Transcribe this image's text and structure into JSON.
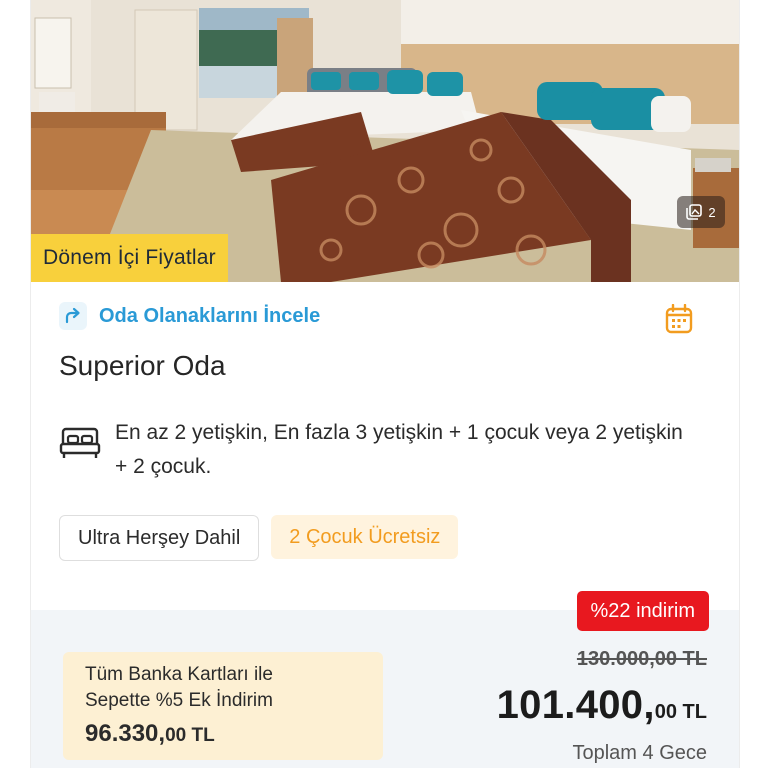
{
  "photo": {
    "alt": "Superior room photo with two beds",
    "gallery_count": "2",
    "gallery_icon": "images-icon"
  },
  "period_tag": "Dönem İçi Fiyatlar",
  "room_link": {
    "label": "Oda Olanaklarını İncele",
    "icon": "share-arrow-icon"
  },
  "calendar_icon": "calendar-icon",
  "room_title": "Superior Oda",
  "capacity": {
    "icon": "bed-icon",
    "text": "En az 2 yetişkin, En fazla 3 yetişkin + 1 çocuk veya 2 yetişkin + 2 çocuk."
  },
  "tags": {
    "board": "Ultra Herşey Dahil",
    "kids": "2 Çocuk Ücretsiz"
  },
  "pricing": {
    "discount": "%22 indirim",
    "old_price": "130.000,00 TL",
    "new_price_main": "101.400,",
    "new_price_decimal": "00 TL",
    "nights": "Toplam 4 Gece",
    "bank_offer": {
      "line1": "Tüm Banka Kartları ile",
      "line2": "Sepette %5 Ek İndirim",
      "price_main": "96.330,",
      "price_decimal": "00 TL"
    }
  },
  "colors": {
    "accent_blue": "#2a9ad6",
    "period_yellow": "#f8d03c",
    "discount_red": "#e8181f",
    "kids_orange": "#f29c1f",
    "bank_box_bg": "#fdf0d3",
    "price_panel_bg": "#f2f5f8"
  }
}
